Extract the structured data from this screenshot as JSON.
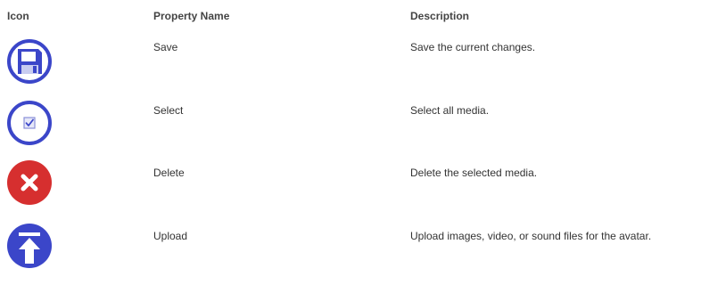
{
  "headers": {
    "icon": "Icon",
    "property_name": "Property Name",
    "description": "Description"
  },
  "rows": [
    {
      "icon": "save-icon",
      "name": "Save",
      "description": "Save the current changes."
    },
    {
      "icon": "select-all-icon",
      "name": "Select",
      "description": "Select all media."
    },
    {
      "icon": "delete-icon",
      "name": "Delete",
      "description": "Delete the selected media."
    },
    {
      "icon": "upload-icon",
      "name": "Upload",
      "description": "Upload images, video, or sound files for the avatar."
    }
  ],
  "colors": {
    "blue": "#3b46c9",
    "red": "#d62f2f",
    "header_text": "#444444",
    "body_text": "#333333"
  }
}
